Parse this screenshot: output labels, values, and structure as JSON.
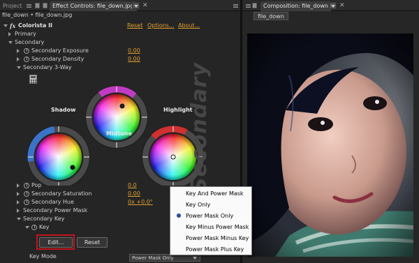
{
  "left_tabs": {
    "project": "Project",
    "effect_controls": "Effect Controls: file_down.jpg"
  },
  "right_tabs": {
    "composition": "Composition: file_down"
  },
  "breadcrumb": "file_down • file_down.jpg",
  "effect": {
    "fx": "fx",
    "name": "Colorista II",
    "reset": "Reset",
    "options": "Options...",
    "about": "About..."
  },
  "rows": {
    "primary": "Primary",
    "secondary": "Secondary",
    "secondary_exposure": "Secondary Exposure",
    "secondary_exposure_value": "0.00",
    "secondary_density": "Secondary Density",
    "secondary_density_value": "0.00",
    "secondary_3way": "Secondary 3-Way",
    "pop": "Pop",
    "pop_value": "0.0",
    "secondary_saturation": "Secondary Saturation",
    "secondary_saturation_value": "0.00",
    "secondary_hue": "Secondary Hue",
    "secondary_hue_value": "0x +0.0°",
    "secondary_power_mask": "Secondary Power Mask",
    "secondary_key": "Secondary Key",
    "key": "Key",
    "key_mode": "Key Mode"
  },
  "wheels": {
    "shadow": "Shadow",
    "midtone": "Midtone",
    "highlight": "Highlight",
    "panel_watermark": "Secondary"
  },
  "buttons": {
    "edit": "Edit...",
    "reset": "Reset"
  },
  "key_mode_select": {
    "selected": "Power Mask Only"
  },
  "popup_menu": {
    "items": [
      "Key And Power Mask",
      "Key Only",
      "Power Mask Only",
      "Key Minus Power Mask",
      "Power Mask Minus Key",
      "Power Mask Plus Key"
    ],
    "selected_item": "Power Mask Only"
  },
  "composition": {
    "tab_label": "file_down"
  },
  "colors": {
    "value_orange": "#e0a030",
    "highlight_red_box": "#c2151b",
    "menu_radio_blue": "#2d53a8"
  }
}
